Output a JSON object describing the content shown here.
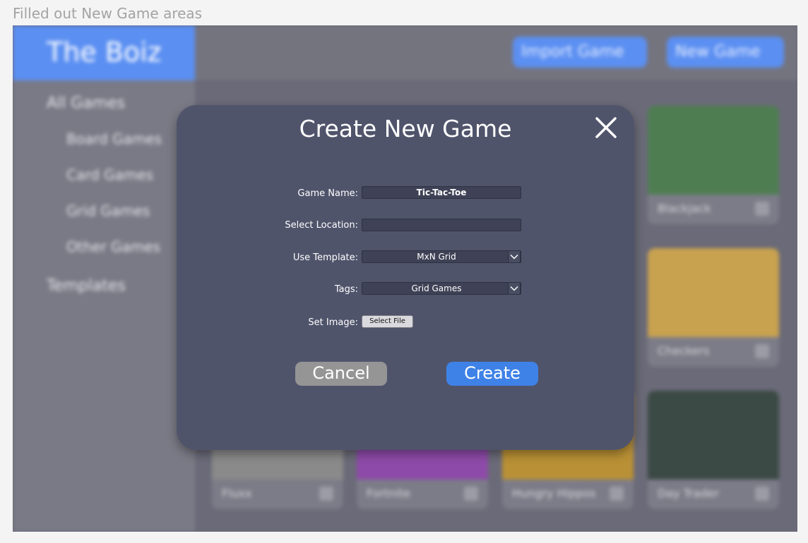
{
  "caption": "Filled out New Game areas",
  "app": {
    "brand": "The Boiz",
    "nav": {
      "all_games": "All Games",
      "board_games": "Board Games",
      "card_games": "Card Games",
      "grid_games": "Grid Games",
      "other_games": "Other Games",
      "templates": "Templates"
    },
    "topbar": {
      "import_label": "Import Game",
      "new_label": "New Game"
    },
    "cards": [
      {
        "title": "Blackjack",
        "thumb_color": "#4f7d52"
      },
      {
        "title": "Checkers",
        "thumb_color": "#c9a24f"
      },
      {
        "title": "Fluxx",
        "thumb_color": "#8a8a8a"
      },
      {
        "title": "Fortnite",
        "thumb_color": "#8e4aa8"
      },
      {
        "title": "Hungry Hippos",
        "thumb_color": "#b99035"
      },
      {
        "title": "Day Trader",
        "thumb_color": "#3c4a45"
      }
    ]
  },
  "modal": {
    "title": "Create New Game",
    "fields": {
      "game_name": {
        "label": "Game Name:",
        "value": "Tic-Tac-Toe"
      },
      "location": {
        "label": "Select Location:",
        "value": ""
      },
      "template": {
        "label": "Use Template:",
        "value": "MxN Grid"
      },
      "tags": {
        "label": "Tags:",
        "value": "Grid Games"
      },
      "image": {
        "label": "Set Image:",
        "button": "Select File"
      }
    },
    "cancel_label": "Cancel",
    "create_label": "Create"
  },
  "colors": {
    "accent": "#5b8ff2",
    "modal_bg": "#50546b",
    "create_button": "#3e82e7",
    "cancel_button": "#959595"
  }
}
